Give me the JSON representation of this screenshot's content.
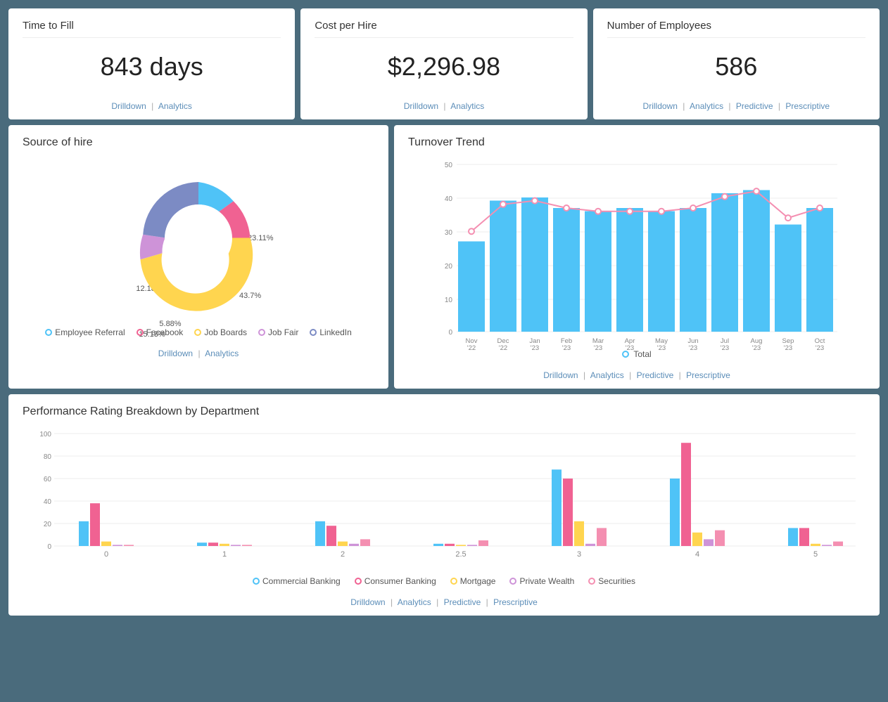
{
  "cards": {
    "time_to_fill": {
      "title": "Time to Fill",
      "value": "843 days",
      "links": [
        "Drilldown",
        "Analytics"
      ]
    },
    "cost_per_hire": {
      "title": "Cost per Hire",
      "value": "$2,296.98",
      "links": [
        "Drilldown",
        "Analytics"
      ]
    },
    "num_employees": {
      "title": "Number of Employees",
      "value": "586",
      "links": [
        "Drilldown",
        "Analytics",
        "Predictive",
        "Prescriptive"
      ]
    }
  },
  "source_of_hire": {
    "title": "Source of hire",
    "segments": [
      {
        "label": "Employee Referral",
        "percent": 15.13,
        "color": "#4fc3f7"
      },
      {
        "label": "Facebook",
        "percent": 12.18,
        "color": "#f06292"
      },
      {
        "label": "Job Boards",
        "percent": 43.7,
        "color": "#ffd54f"
      },
      {
        "label": "Job Fair",
        "percent": 5.88,
        "color": "#ce93d8"
      },
      {
        "label": "LinkedIn",
        "percent": 23.11,
        "color": "#7c8bc4"
      }
    ],
    "links": [
      "Drilldown",
      "Analytics"
    ]
  },
  "turnover_trend": {
    "title": "Turnover Trend",
    "months": [
      "Nov '22",
      "Dec '22",
      "Jan '23",
      "Feb '23",
      "Mar '23",
      "Apr '23",
      "May '23",
      "Jun '23",
      "Jul '23",
      "Aug '23",
      "Sep '23",
      "Oct '23"
    ],
    "values": [
      27,
      38,
      40,
      37,
      36,
      37,
      36,
      37,
      42,
      43,
      32,
      37
    ],
    "line_values": [
      30,
      38,
      39,
      37,
      36,
      36,
      36,
      37,
      41,
      42,
      34,
      37
    ],
    "legend": "Total",
    "links": [
      "Drilldown",
      "Analytics",
      "Predictive",
      "Prescriptive"
    ]
  },
  "performance": {
    "title": "Performance Rating Breakdown by Department",
    "categories": [
      0,
      1,
      2,
      2.5,
      3,
      4,
      5
    ],
    "departments": [
      {
        "label": "Commercial Banking",
        "color": "#4fc3f7",
        "values": [
          22,
          3,
          22,
          2,
          68,
          60,
          16
        ]
      },
      {
        "label": "Consumer Banking",
        "color": "#f06292",
        "values": [
          38,
          3,
          18,
          2,
          60,
          92,
          16
        ]
      },
      {
        "label": "Mortgage",
        "color": "#ffd54f",
        "values": [
          4,
          2,
          4,
          1,
          22,
          12,
          2
        ]
      },
      {
        "label": "Private Wealth",
        "color": "#ce93d8",
        "values": [
          1,
          1,
          2,
          1,
          2,
          6,
          1
        ]
      },
      {
        "label": "Securities",
        "color": "#f48fb1",
        "values": [
          1,
          1,
          6,
          5,
          16,
          14,
          4
        ]
      }
    ],
    "links": [
      "Drilldown",
      "Analytics",
      "Predictive",
      "Prescriptive"
    ]
  },
  "colors": {
    "accent_blue": "#5b8db8",
    "separator": "#aaa"
  }
}
